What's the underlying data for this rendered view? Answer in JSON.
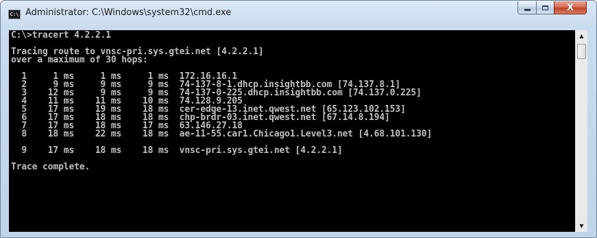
{
  "window": {
    "title": "Administrator: C:\\Windows\\system32\\cmd.exe",
    "app_icon_text": "C:\\",
    "controls": {
      "minimize": "minimize-icon",
      "maximize": "maximize-icon",
      "close": "close-icon",
      "close_glyph": "X"
    }
  },
  "console": {
    "lines": [
      "C:\\>tracert 4.2.2.1",
      "",
      "Tracing route to vnsc-pri.sys.gtei.net [4.2.2.1]",
      "over a maximum of 30 hops:",
      "",
      "  1     1 ms     1 ms     1 ms  172.16.16.1",
      "  2     9 ms     9 ms     9 ms  74-137-8-1.dhcp.insightbb.com [74.137.8.1]",
      "  3    12 ms     9 ms     9 ms  74-137-0-225.dhcp.insightbb.com [74.137.0.225]",
      "  4    11 ms    11 ms    10 ms  74.128.9.205",
      "  5    17 ms    19 ms    18 ms  cer-edge-13.inet.qwest.net [65.123.102.153]",
      "  6    17 ms    18 ms    18 ms  chp-brdr-03.inet.qwest.net [67.14.8.194]",
      "  7    17 ms    18 ms    17 ms  63.146.27.18",
      "  8    18 ms    22 ms    18 ms  ae-11-55.car1.Chicago1.Level3.net [4.68.101.130]",
      "",
      "  9    17 ms    18 ms    18 ms  vnsc-pri.sys.gtei.net [4.2.2.1]",
      "",
      "Trace complete."
    ]
  },
  "scrollbar": {
    "up_arrow": "▲",
    "down_arrow": "▼"
  },
  "colors": {
    "console_background": "#000000",
    "console_text": "#c0c0c0",
    "close_button": "#c74a32",
    "title_bar": "#c8dbef"
  }
}
